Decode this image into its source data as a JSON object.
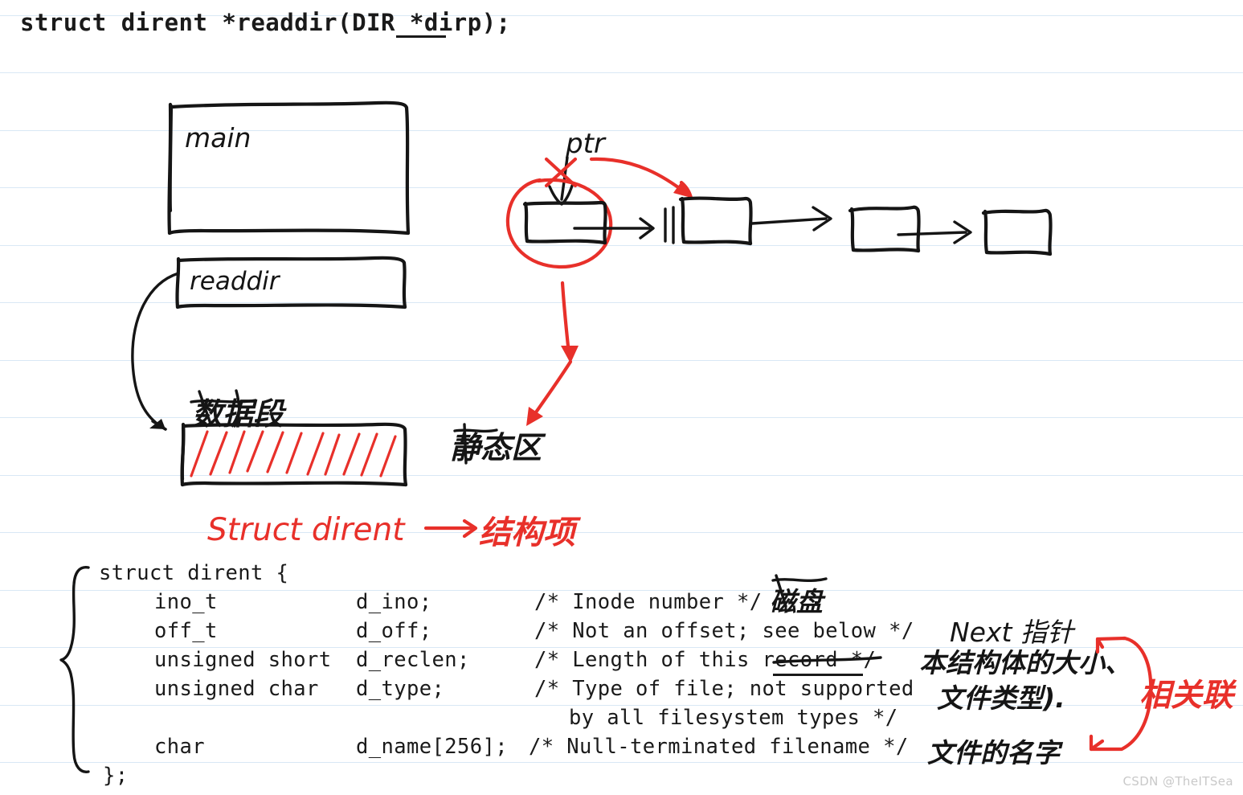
{
  "page": {
    "background_color": "#ffffff",
    "rule_color": "#d9e8f5",
    "ink_black": "#151515",
    "ink_red": "#e8302a",
    "rule_positions": [
      19,
      90,
      162,
      233,
      305,
      376,
      448,
      519,
      591,
      662,
      734,
      805,
      877,
      948
    ],
    "watermark": "CSDN @TheITSea"
  },
  "signature": {
    "before": "struct dirent *readdir(DIR *",
    "param": "dirp",
    "after": ");",
    "full": "struct dirent *readdir(DIR *dirp);"
  },
  "diagram": {
    "stack_boxes": [
      {
        "label": "main",
        "name": "main-frame-box"
      },
      {
        "label": "readdir",
        "name": "readdir-frame-box"
      }
    ],
    "data_segment": {
      "label": "数据段",
      "label_meaning": "data segment",
      "hatch_color": "#e8302a"
    },
    "pointer": {
      "label": "ptr",
      "crossed_out": true,
      "cross_color": "#e8302a"
    },
    "static_area": {
      "label": "静态区",
      "label_meaning": "static area"
    },
    "linked_list": {
      "node_count": 4,
      "first_node_circled": true,
      "circle_color": "#e8302a"
    },
    "struct_caption": {
      "text_latin": "Struct dirent",
      "arrow": "→",
      "text_cjk": "结构项",
      "color": "#e8302a"
    }
  },
  "struct_code": {
    "open": "struct dirent {",
    "close": "};",
    "fields": [
      {
        "type": "ino_t",
        "name": "d_ino;",
        "comment": "/* Inode number */",
        "annotation": "磁盘",
        "annotation_color": "#151515"
      },
      {
        "type": "off_t",
        "name": "d_off;",
        "comment": "/* Not an offset; see below */",
        "annotation": "Next 指针",
        "annotation_color": "#151515"
      },
      {
        "type": "unsigned short",
        "name": "d_reclen;",
        "comment": "/* Length of this record */",
        "comment_struck": "record",
        "annotation": "本结构体的大小、",
        "annotation_color": "#151515"
      },
      {
        "type": "unsigned char",
        "name": "d_type;",
        "comment": "/* Type of file; not supported",
        "comment_cont": "by all filesystem types */",
        "annotation": "文件类型).",
        "annotation_color": "#151515"
      },
      {
        "type": "char",
        "name": "d_name[256];",
        "comment": "/* Null-terminated filename */",
        "annotation": "文件的名字",
        "annotation_color": "#151515"
      }
    ],
    "relation_note": {
      "text": "相关联",
      "meaning": "associated",
      "color": "#e8302a"
    }
  }
}
